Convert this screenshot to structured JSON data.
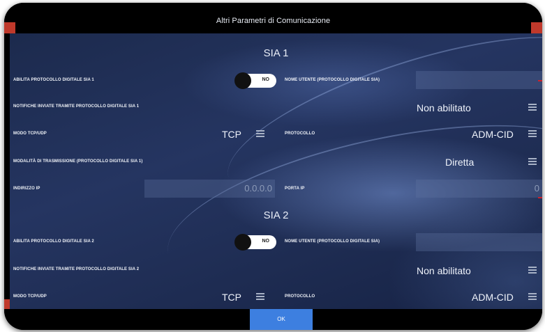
{
  "window": {
    "title": "Altri Parametri di Comunicazione"
  },
  "sections": [
    {
      "header": "SIA 1",
      "enable_label": "ABILITA PROTOCOLLO DIGITALE SIA 1",
      "enable_toggle": "NO",
      "username_label": "NOME UTENTE (PROTOCOLLO DIGITALE SIA)",
      "username_value": "",
      "notifications_label": "NOTIFICHE INVIATE TRAMITE PROTOCOLLO DIGITALE SIA 1",
      "notifications_value": "Non abilitato",
      "mode_label": "MODO TCP/UDP",
      "mode_value": "TCP",
      "protocol_label": "PROTOCOLLO",
      "protocol_value": "ADM-CID",
      "transmission_label": "MODALITÀ DI TRASMISSIONE (PROTOCOLLO DIGITALE SIA 1)",
      "transmission_value": "Diretta",
      "ip_label": "INDIRIZZO IP",
      "ip_value": "0.0.0.0",
      "port_label": "PORTA IP",
      "port_value": "0"
    },
    {
      "header": "SIA 2",
      "enable_label": "ABILITA PROTOCOLLO DIGITALE SIA 2",
      "enable_toggle": "NO",
      "username_label": "NOME UTENTE (PROTOCOLLO DIGITALE SIA)",
      "username_value": "",
      "notifications_label": "NOTIFICHE INVIATE TRAMITE PROTOCOLLO DIGITALE SIA 2",
      "notifications_value": "Non abilitato",
      "mode_label": "MODO TCP/UDP",
      "mode_value": "TCP",
      "protocol_label": "PROTOCOLLO",
      "protocol_value": "ADM-CID"
    }
  ],
  "footer": {
    "ok_label": "OK"
  },
  "colors": {
    "accent": "#3d7fe0",
    "error_marker": "#d0202a",
    "background": "#1e2c52"
  },
  "icons": {
    "menu": "menu-icon",
    "toggle": "toggle-switch"
  }
}
